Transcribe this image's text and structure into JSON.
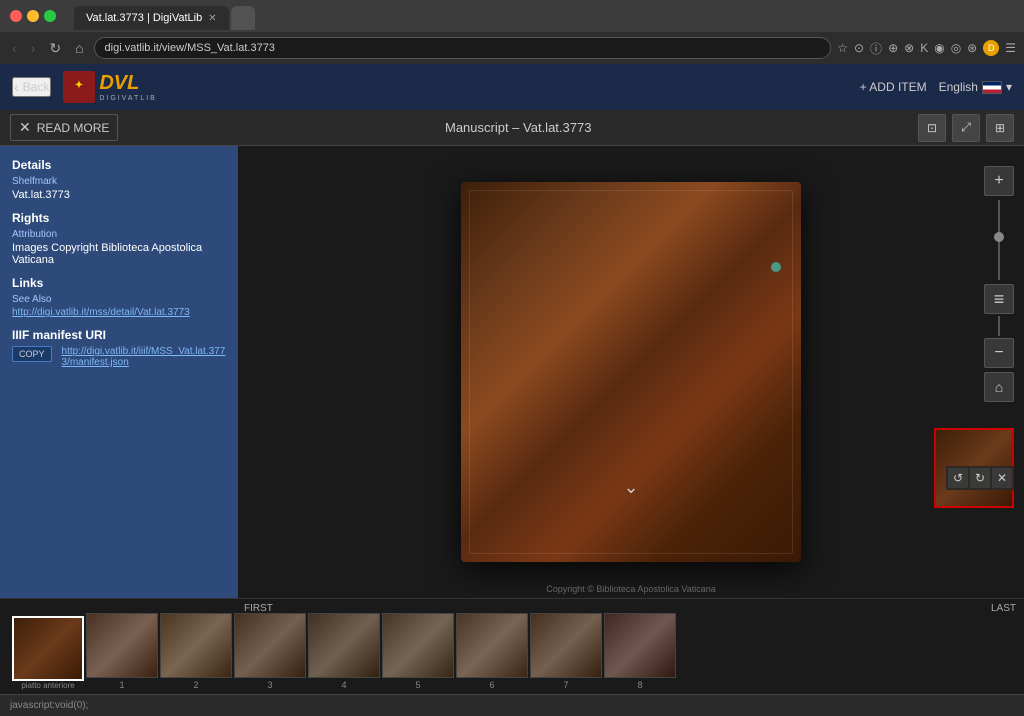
{
  "browser": {
    "tabs": [
      {
        "label": "Vat.lat.3773 | DigiVatLib",
        "active": true
      },
      {
        "label": "",
        "active": false
      }
    ],
    "url": "digi.vatlib.it/view/MSS_Vat.lat.3773",
    "profile_label": "Dot"
  },
  "header": {
    "back_label": "Back",
    "logo_text": "DVL",
    "logo_sub": "DIGIVATLIB",
    "add_item_label": "+ ADD ITEM",
    "language_label": "English"
  },
  "toolbar": {
    "read_more_label": "READ MORE",
    "title": "Manuscript – Vat.lat.3773"
  },
  "sidebar": {
    "details_heading": "Details",
    "shelfmark_label": "Shelfmark",
    "shelfmark_value": "Vat.lat.3773",
    "rights_heading": "Rights",
    "attribution_label": "Attribution",
    "attribution_value": "Images Copyright Biblioteca Apostolica Vaticana",
    "links_heading": "Links",
    "see_also_label": "See Also",
    "see_also_url": "http://digi.vatlib.it/mss/detail/Vat.lat.3773",
    "iiif_heading": "IIIF manifest URI",
    "copy_label": "COPY",
    "iiif_url": "http://digi.vatlib.it/iiif/MSS_Vat.lat.3773/manifest.json"
  },
  "thumbnails": {
    "first_label": "FIRST",
    "last_label": "LAST",
    "items": [
      {
        "num": "",
        "label": "piatto anteriore",
        "active": true
      },
      {
        "num": "1",
        "label": ""
      },
      {
        "num": "2",
        "label": ""
      },
      {
        "num": "3",
        "label": ""
      },
      {
        "num": "4",
        "label": ""
      },
      {
        "num": "5",
        "label": ""
      },
      {
        "num": "6",
        "label": ""
      },
      {
        "num": "7",
        "label": ""
      },
      {
        "num": "8",
        "label": ""
      }
    ]
  },
  "status_bar": {
    "text": "javascript:void(0);"
  },
  "copyright": "Copyright © Biblioteca Apostolica Vaticana"
}
